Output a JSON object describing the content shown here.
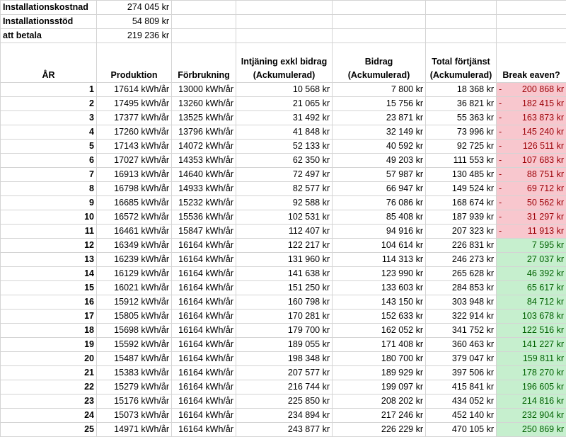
{
  "summary": [
    {
      "label": "Installationskostnad",
      "value": "274 045 kr"
    },
    {
      "label": "Installationsstöd",
      "value": "54 809 kr"
    },
    {
      "label": "att betala",
      "value": "219 236 kr"
    }
  ],
  "headers": {
    "year": "ÅR",
    "production": "Produktion",
    "consumption": "Förbrukning",
    "earnings_line1": "Intjäning exkl bidrag",
    "earnings_line2": "(Ackumulerad)",
    "grant_line1": "Bidrag",
    "grant_line2": "(Ackumulerad)",
    "total_line1": "Total förtjänst",
    "total_line2": "(Ackumulerad)",
    "breakeven": "Break eaven?"
  },
  "rows": [
    {
      "year": "1",
      "production": "17614 kWh/år",
      "consumption": "13000 kWh/år",
      "earnings": "10 568 kr",
      "grant": "7 800 kr",
      "total": "18 368 kr",
      "breakeven": "200 868 kr",
      "negative": true,
      "sign": "-"
    },
    {
      "year": "2",
      "production": "17495 kWh/år",
      "consumption": "13260 kWh/år",
      "earnings": "21 065 kr",
      "grant": "15 756 kr",
      "total": "36 821 kr",
      "breakeven": "182 415 kr",
      "negative": true,
      "sign": "-"
    },
    {
      "year": "3",
      "production": "17377 kWh/år",
      "consumption": "13525 kWh/år",
      "earnings": "31 492 kr",
      "grant": "23 871 kr",
      "total": "55 363 kr",
      "breakeven": "163 873 kr",
      "negative": true,
      "sign": "-"
    },
    {
      "year": "4",
      "production": "17260 kWh/år",
      "consumption": "13796 kWh/år",
      "earnings": "41 848 kr",
      "grant": "32 149 kr",
      "total": "73 996 kr",
      "breakeven": "145 240 kr",
      "negative": true,
      "sign": "-"
    },
    {
      "year": "5",
      "production": "17143 kWh/år",
      "consumption": "14072 kWh/år",
      "earnings": "52 133 kr",
      "grant": "40 592 kr",
      "total": "92 725 kr",
      "breakeven": "126 511 kr",
      "negative": true,
      "sign": "-"
    },
    {
      "year": "6",
      "production": "17027 kWh/år",
      "consumption": "14353 kWh/år",
      "earnings": "62 350 kr",
      "grant": "49 203 kr",
      "total": "111 553 kr",
      "breakeven": "107 683 kr",
      "negative": true,
      "sign": "-"
    },
    {
      "year": "7",
      "production": "16913 kWh/år",
      "consumption": "14640 kWh/år",
      "earnings": "72 497 kr",
      "grant": "57 987 kr",
      "total": "130 485 kr",
      "breakeven": "88 751 kr",
      "negative": true,
      "sign": "-"
    },
    {
      "year": "8",
      "production": "16798 kWh/år",
      "consumption": "14933 kWh/år",
      "earnings": "82 577 kr",
      "grant": "66 947 kr",
      "total": "149 524 kr",
      "breakeven": "69 712 kr",
      "negative": true,
      "sign": "-"
    },
    {
      "year": "9",
      "production": "16685 kWh/år",
      "consumption": "15232 kWh/år",
      "earnings": "92 588 kr",
      "grant": "76 086 kr",
      "total": "168 674 kr",
      "breakeven": "50 562 kr",
      "negative": true,
      "sign": "-"
    },
    {
      "year": "10",
      "production": "16572 kWh/år",
      "consumption": "15536 kWh/år",
      "earnings": "102 531 kr",
      "grant": "85 408 kr",
      "total": "187 939 kr",
      "breakeven": "31 297 kr",
      "negative": true,
      "sign": "-"
    },
    {
      "year": "11",
      "production": "16461 kWh/år",
      "consumption": "15847 kWh/år",
      "earnings": "112 407 kr",
      "grant": "94 916 kr",
      "total": "207 323 kr",
      "breakeven": "11 913 kr",
      "negative": true,
      "sign": "-"
    },
    {
      "year": "12",
      "production": "16349 kWh/år",
      "consumption": "16164 kWh/år",
      "earnings": "122 217 kr",
      "grant": "104 614 kr",
      "total": "226 831 kr",
      "breakeven": "7 595 kr",
      "negative": false,
      "sign": ""
    },
    {
      "year": "13",
      "production": "16239 kWh/år",
      "consumption": "16164 kWh/år",
      "earnings": "131 960 kr",
      "grant": "114 313 kr",
      "total": "246 273 kr",
      "breakeven": "27 037 kr",
      "negative": false,
      "sign": ""
    },
    {
      "year": "14",
      "production": "16129 kWh/år",
      "consumption": "16164 kWh/år",
      "earnings": "141 638 kr",
      "grant": "123 990 kr",
      "total": "265 628 kr",
      "breakeven": "46 392 kr",
      "negative": false,
      "sign": ""
    },
    {
      "year": "15",
      "production": "16021 kWh/år",
      "consumption": "16164 kWh/år",
      "earnings": "151 250 kr",
      "grant": "133 603 kr",
      "total": "284 853 kr",
      "breakeven": "65 617 kr",
      "negative": false,
      "sign": ""
    },
    {
      "year": "16",
      "production": "15912 kWh/år",
      "consumption": "16164 kWh/år",
      "earnings": "160 798 kr",
      "grant": "143 150 kr",
      "total": "303 948 kr",
      "breakeven": "84 712 kr",
      "negative": false,
      "sign": ""
    },
    {
      "year": "17",
      "production": "15805 kWh/år",
      "consumption": "16164 kWh/år",
      "earnings": "170 281 kr",
      "grant": "152 633 kr",
      "total": "322 914 kr",
      "breakeven": "103 678 kr",
      "negative": false,
      "sign": ""
    },
    {
      "year": "18",
      "production": "15698 kWh/år",
      "consumption": "16164 kWh/år",
      "earnings": "179 700 kr",
      "grant": "162 052 kr",
      "total": "341 752 kr",
      "breakeven": "122 516 kr",
      "negative": false,
      "sign": ""
    },
    {
      "year": "19",
      "production": "15592 kWh/år",
      "consumption": "16164 kWh/år",
      "earnings": "189 055 kr",
      "grant": "171 408 kr",
      "total": "360 463 kr",
      "breakeven": "141 227 kr",
      "negative": false,
      "sign": ""
    },
    {
      "year": "20",
      "production": "15487 kWh/år",
      "consumption": "16164 kWh/år",
      "earnings": "198 348 kr",
      "grant": "180 700 kr",
      "total": "379 047 kr",
      "breakeven": "159 811 kr",
      "negative": false,
      "sign": ""
    },
    {
      "year": "21",
      "production": "15383 kWh/år",
      "consumption": "16164 kWh/år",
      "earnings": "207 577 kr",
      "grant": "189 929 kr",
      "total": "397 506 kr",
      "breakeven": "178 270 kr",
      "negative": false,
      "sign": ""
    },
    {
      "year": "22",
      "production": "15279 kWh/år",
      "consumption": "16164 kWh/år",
      "earnings": "216 744 kr",
      "grant": "199 097 kr",
      "total": "415 841 kr",
      "breakeven": "196 605 kr",
      "negative": false,
      "sign": ""
    },
    {
      "year": "23",
      "production": "15176 kWh/år",
      "consumption": "16164 kWh/år",
      "earnings": "225 850 kr",
      "grant": "208 202 kr",
      "total": "434 052 kr",
      "breakeven": "214 816 kr",
      "negative": false,
      "sign": ""
    },
    {
      "year": "24",
      "production": "15073 kWh/år",
      "consumption": "16164 kWh/år",
      "earnings": "234 894 kr",
      "grant": "217 246 kr",
      "total": "452 140 kr",
      "breakeven": "232 904 kr",
      "negative": false,
      "sign": ""
    },
    {
      "year": "25",
      "production": "14971 kWh/år",
      "consumption": "16164 kWh/år",
      "earnings": "243 877 kr",
      "grant": "226 229 kr",
      "total": "470 105 kr",
      "breakeven": "250 869 kr",
      "negative": false,
      "sign": ""
    }
  ],
  "colors": {
    "negative_fill": "#f8c7ce",
    "negative_text": "#9c0006",
    "positive_fill": "#c6efce",
    "positive_text": "#006100",
    "gridline": "#d4d4d4"
  }
}
